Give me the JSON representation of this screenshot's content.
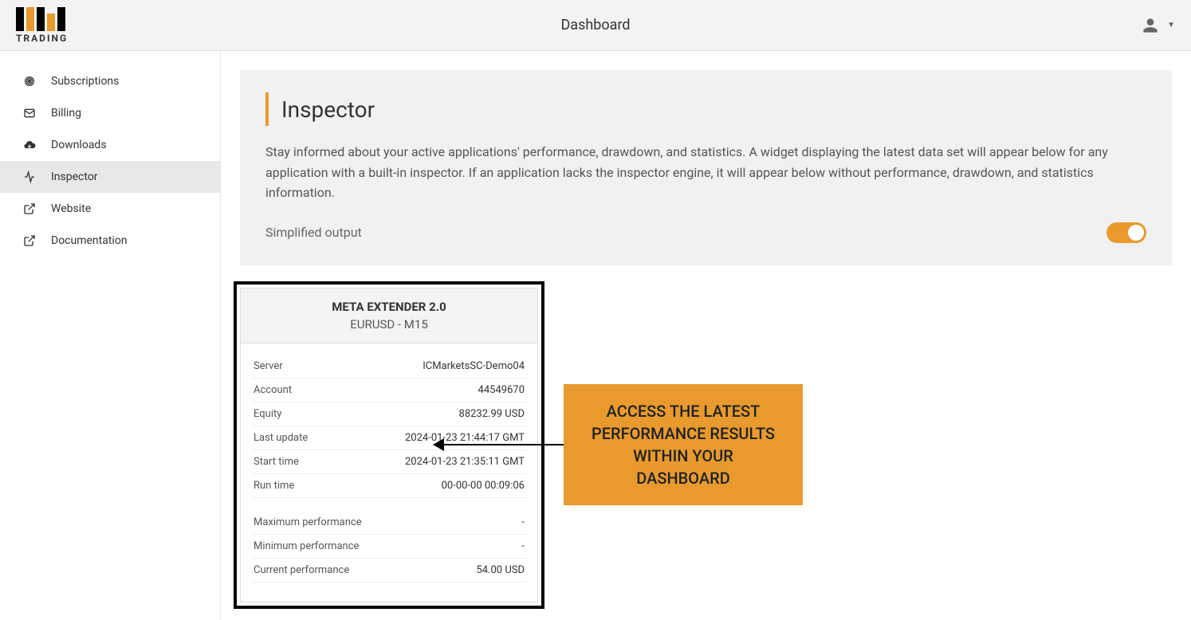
{
  "header": {
    "title": "Dashboard",
    "logo_text": "TRADING"
  },
  "sidebar": {
    "items": [
      {
        "label": "Subscriptions",
        "icon": "broadcast"
      },
      {
        "label": "Billing",
        "icon": "mail"
      },
      {
        "label": "Downloads",
        "icon": "cloud-download"
      },
      {
        "label": "Inspector",
        "icon": "activity",
        "active": true
      },
      {
        "label": "Website",
        "icon": "external-link"
      },
      {
        "label": "Documentation",
        "icon": "external-link"
      }
    ]
  },
  "inspector": {
    "title": "Inspector",
    "description": "Stay informed about your active applications' performance, drawdown, and statistics. A widget displaying the latest data set will appear below for any application with a built-in inspector. If an application lacks the inspector engine, it will appear below without performance, drawdown, and statistics information.",
    "simplified_label": "Simplified output",
    "simplified_on": true
  },
  "widget": {
    "title": "META EXTENDER 2.0",
    "subtitle": "EURUSD - M15",
    "rows1": [
      {
        "label": "Server",
        "value": "ICMarketsSC-Demo04"
      },
      {
        "label": "Account",
        "value": "44549670"
      },
      {
        "label": "Equity",
        "value": "88232.99 USD"
      },
      {
        "label": "Last update",
        "value": "2024-01-23 21:44:17 GMT"
      },
      {
        "label": "Start time",
        "value": "2024-01-23 21:35:11 GMT"
      },
      {
        "label": "Run time",
        "value": "00-00-00 00:09:06"
      }
    ],
    "rows2": [
      {
        "label": "Maximum performance",
        "value": "-"
      },
      {
        "label": "Minimum performance",
        "value": "-"
      },
      {
        "label": "Current performance",
        "value": "54.00 USD"
      }
    ]
  },
  "callout": {
    "text": "ACCESS THE LATEST PERFORMANCE RESULTS WITHIN YOUR DASHBOARD"
  }
}
